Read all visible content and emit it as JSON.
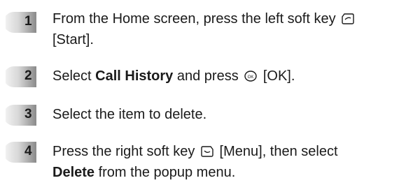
{
  "steps": [
    {
      "number": "1",
      "line1_a": "From the Home screen, press the left soft key",
      "icon": "left-soft-key-icon",
      "line2": "[Start]."
    },
    {
      "number": "2",
      "text_a": "Select ",
      "bold": "Call History",
      "text_b": " and press",
      "icon": "ok-key-icon",
      "text_c": "[OK]."
    },
    {
      "number": "3",
      "text": "Select the item to delete."
    },
    {
      "number": "4",
      "line1_a": "Press the right soft key",
      "icon": "right-soft-key-icon",
      "line1_b": "[Menu], then select",
      "bold": "Delete",
      "line2_b": " from the popup menu."
    }
  ],
  "colors": {
    "badge_light": "#eeeeee",
    "badge_dark": "#8a8a8a",
    "text": "#1a1a1a"
  }
}
